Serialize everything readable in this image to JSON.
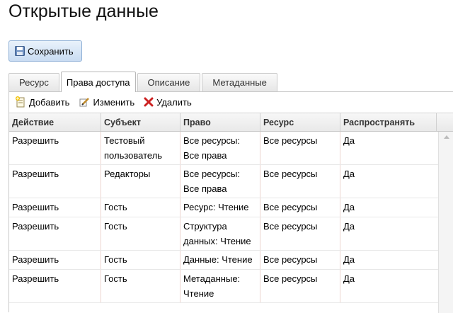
{
  "page": {
    "title": "Открытые данные"
  },
  "save_button": {
    "label": "Сохранить"
  },
  "tabs": [
    {
      "label": "Ресурс",
      "active": false
    },
    {
      "label": "Права доступа",
      "active": true
    },
    {
      "label": "Описание",
      "active": false
    },
    {
      "label": "Метаданные",
      "active": false
    }
  ],
  "toolbar": {
    "add_label": "Добавить",
    "edit_label": "Изменить",
    "delete_label": "Удалить"
  },
  "grid": {
    "columns": [
      "Действие",
      "Субъект",
      "Право",
      "Ресурс",
      "Распространять"
    ],
    "rows": [
      [
        "Разрешить",
        "Тестовый пользователь",
        "Все ресурсы: Все права",
        "Все ресурсы",
        "Да"
      ],
      [
        "Разрешить",
        "Редакторы",
        "Все ресурсы: Все права",
        "Все ресурсы",
        "Да"
      ],
      [
        "Разрешить",
        "Гость",
        "Ресурс: Чтение",
        "Все ресурсы",
        "Да"
      ],
      [
        "Разрешить",
        "Гость",
        "Структура данных: Чтение",
        "Все ресурсы",
        "Да"
      ],
      [
        "Разрешить",
        "Гость",
        "Данные: Чтение",
        "Все ресурсы",
        "Да"
      ],
      [
        "Разрешить",
        "Гость",
        "Метаданные: Чтение",
        "Все ресурсы",
        "Да"
      ]
    ]
  },
  "colors": {
    "delete_icon": "#cc2222",
    "accent": "#8fb0d6"
  }
}
